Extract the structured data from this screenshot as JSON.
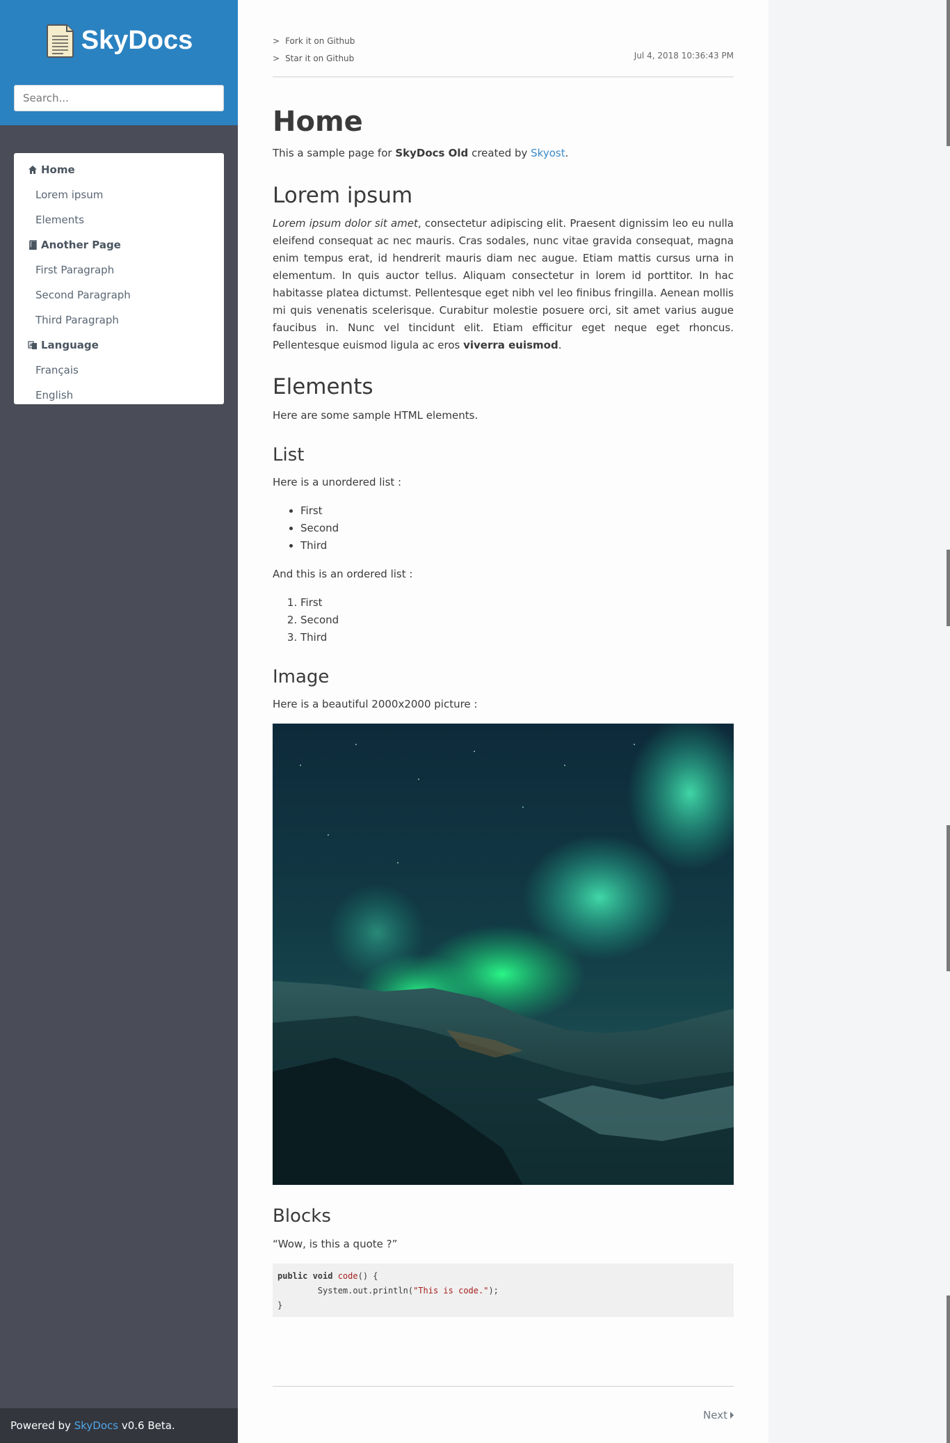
{
  "sidebar": {
    "brand": "SkyDocs",
    "search_placeholder": "Search...",
    "nav": [
      {
        "label": "Home",
        "type": "section"
      },
      {
        "label": "Lorem ipsum",
        "type": "child"
      },
      {
        "label": "Elements",
        "type": "child"
      },
      {
        "label": "Another Page",
        "type": "section"
      },
      {
        "label": "First Paragraph",
        "type": "child"
      },
      {
        "label": "Second Paragraph",
        "type": "child"
      },
      {
        "label": "Third Paragraph",
        "type": "child"
      },
      {
        "label": "Language",
        "type": "section"
      },
      {
        "label": "Français",
        "type": "child"
      },
      {
        "label": "English",
        "type": "child"
      }
    ],
    "footer": {
      "prefix": "Powered by ",
      "link": "SkyDocs",
      "suffix": " v0.6 Beta."
    }
  },
  "header": {
    "links": [
      "Fork it on Github",
      "Star it on Github"
    ],
    "link_arrow": ">",
    "timestamp": "Jul 4, 2018 10:36:43 PM"
  },
  "main": {
    "title": "Home",
    "intro": {
      "before": "This a sample page for ",
      "bold": "SkyDocs Old",
      "middle": " created by ",
      "link": "Skyost",
      "after": "."
    },
    "lorem": {
      "heading": "Lorem ipsum",
      "italic": "Lorem ipsum dolor sit amet",
      "text": ", consectetur adipiscing elit. Praesent dignissim leo eu nulla eleifend consequat ac nec mauris. Cras sodales, nunc vitae gravida consequat, magna enim tempus erat, id hendrerit mauris diam nec augue. Etiam mattis cursus urna in elementum. In quis auctor tellus. Aliquam consectetur in lorem id porttitor. In hac habitasse platea dictumst. Pellentesque eget nibh vel leo finibus fringilla. Aenean mollis mi quis venenatis scelerisque. Curabitur molestie posuere orci, sit amet varius augue faucibus in. Nunc vel tincidunt elit. Etiam efficitur eget neque eget rhoncus. Pellentesque euismod ligula ac eros ",
      "bold": "viverra euismod",
      "end": "."
    },
    "elements": {
      "heading": "Elements",
      "text": "Here are some sample HTML elements."
    },
    "list": {
      "heading": "List",
      "unordered_intro": "Here is a unordered list :",
      "unordered": [
        "First",
        "Second",
        "Third"
      ],
      "ordered_intro": "And this is an ordered list :",
      "ordered": [
        "First",
        "Second",
        "Third"
      ]
    },
    "image": {
      "heading": "Image",
      "text": "Here is a beautiful 2000x2000 picture :"
    },
    "blocks": {
      "heading": "Blocks",
      "quote": "“Wow, is this a quote ?”",
      "code": {
        "line1_kw": "public void ",
        "line1_fn": "code",
        "line1_rest": "() {",
        "line2_pre": "        System.out.println(",
        "line2_str": "\"This is code.\"",
        "line2_post": ");",
        "line3": "}"
      }
    },
    "next_label": "Next"
  },
  "colors": {
    "header_blue": "#2b82c1",
    "sidebar_gray": "#4a4d57",
    "footer_dark": "#34363e",
    "link_blue": "#3a8bc9"
  }
}
